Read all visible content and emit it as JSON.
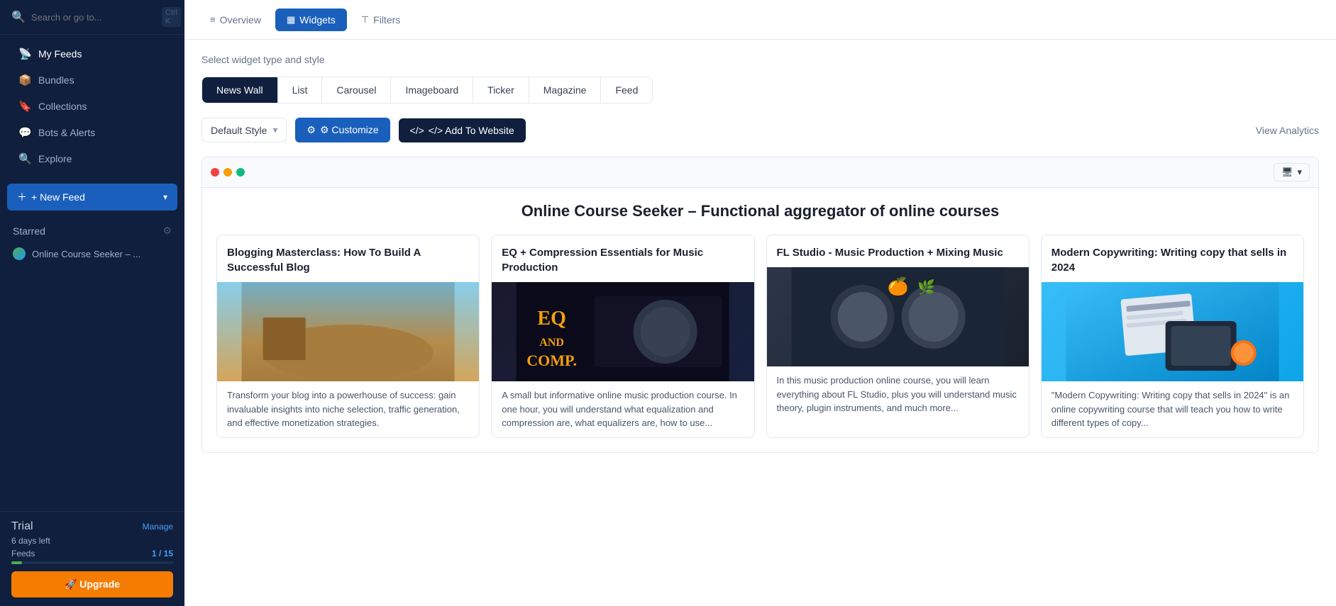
{
  "sidebar": {
    "search_placeholder": "Search or go to...",
    "search_shortcut": "Ctrl K",
    "nav_items": [
      {
        "id": "my-feeds",
        "label": "My Feeds",
        "icon": "📡",
        "active": true
      },
      {
        "id": "bundles",
        "label": "Bundles",
        "icon": "📦"
      },
      {
        "id": "collections",
        "label": "Collections",
        "icon": "🔖"
      },
      {
        "id": "bots-alerts",
        "label": "Bots & Alerts",
        "icon": "💬"
      },
      {
        "id": "explore",
        "label": "Explore",
        "icon": "🔍"
      }
    ],
    "new_feed_label": "+ New Feed",
    "starred_label": "Starred",
    "feed_items": [
      {
        "id": "online-course-seeker",
        "label": "Online Course Seeker – ..."
      }
    ],
    "trial": {
      "label": "Trial",
      "sub_label": "6 days left",
      "manage_label": "Manage",
      "feeds_label": "Feeds",
      "feeds_count": "1 / 15",
      "progress_pct": 6.67,
      "upgrade_label": "🚀 Upgrade"
    }
  },
  "top_nav": {
    "tabs": [
      {
        "id": "overview",
        "label": "Overview",
        "icon": "≡",
        "active": false
      },
      {
        "id": "widgets",
        "label": "Widgets",
        "icon": "▦",
        "active": true
      },
      {
        "id": "filters",
        "label": "Filters",
        "icon": "⊤",
        "active": false
      }
    ]
  },
  "widget_area": {
    "select_label": "Select widget type and style",
    "widget_tabs": [
      {
        "id": "news-wall",
        "label": "News Wall",
        "active": true
      },
      {
        "id": "list",
        "label": "List",
        "active": false
      },
      {
        "id": "carousel",
        "label": "Carousel",
        "active": false
      },
      {
        "id": "imageboard",
        "label": "Imageboard",
        "active": false
      },
      {
        "id": "ticker",
        "label": "Ticker",
        "active": false
      },
      {
        "id": "magazine",
        "label": "Magazine",
        "active": false
      },
      {
        "id": "feed",
        "label": "Feed",
        "active": false
      }
    ],
    "style_select": {
      "value": "Default Style"
    },
    "customize_label": "⚙ Customize",
    "add_website_label": "</> Add To Website",
    "view_analytics_label": "View Analytics",
    "preview": {
      "title": "Online Course Seeker – Functional aggregator of online courses",
      "device_switcher_icon": "🖥",
      "cards": [
        {
          "id": "card-1",
          "title": "Blogging Masterclass: How To Build A Successful Blog",
          "description": "Transform your blog into a powerhouse of success: gain invaluable insights into niche selection, traffic generation, and effective monetization strategies.",
          "img_type": "blog"
        },
        {
          "id": "card-2",
          "title": "EQ + Compression Essentials for Music Production",
          "description": "A small but informative online music production course. In one hour, you will understand what equalization and compression are, what equalizers are, how to use...",
          "img_type": "eq"
        },
        {
          "id": "card-3",
          "title": "FL Studio - Music Production + Mixing Music",
          "description": "In this music production online course, you will learn everything about FL Studio, plus you will understand music theory, plugin instruments, and much more...",
          "img_type": "fl"
        },
        {
          "id": "card-4",
          "title": "Modern Copywriting: Writing copy that sells in 2024",
          "description": "\"Modern Copywriting: Writing copy that sells in 2024\" is an online copywriting course that will teach you how to write different types of copy...",
          "img_type": "copy"
        }
      ]
    }
  }
}
